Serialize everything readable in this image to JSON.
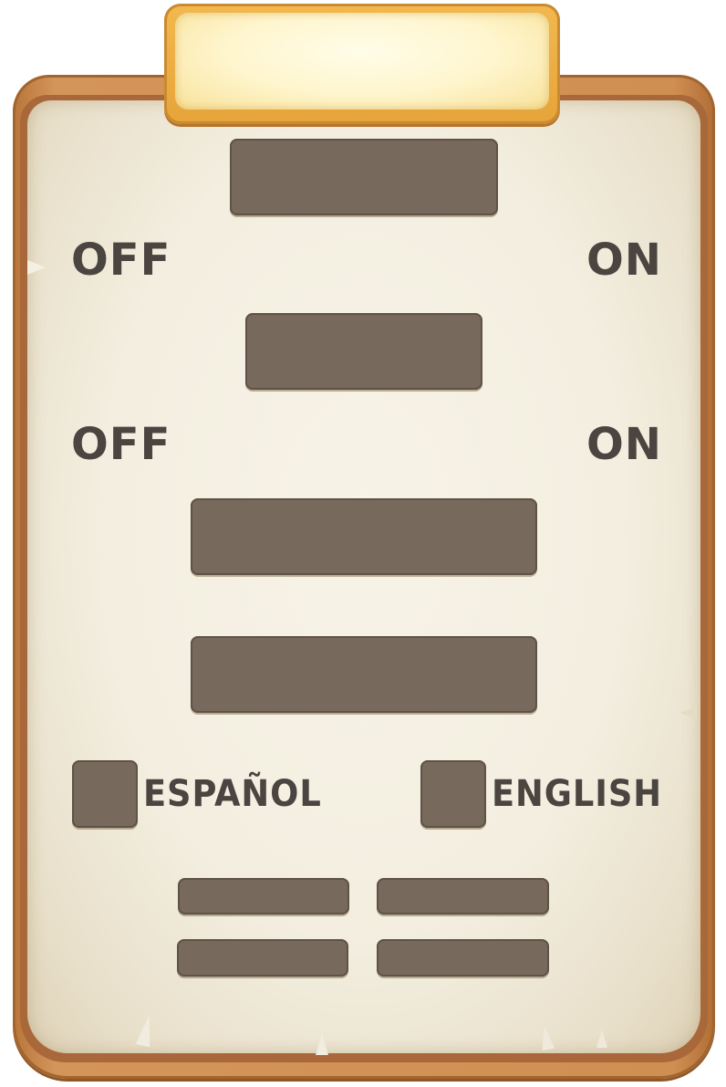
{
  "header": {
    "title": ""
  },
  "toggles": [
    {
      "off_label": "OFF",
      "on_label": "ON"
    },
    {
      "off_label": "OFF",
      "on_label": "ON"
    }
  ],
  "languages": [
    {
      "label": "ESPAÑOL"
    },
    {
      "label": "ENGLISH"
    }
  ],
  "colors": {
    "wood": "#d08f52",
    "paper": "#f3eee0",
    "plaque": "#fff6cf",
    "button": "#776a5c",
    "text": "#4a4540"
  }
}
